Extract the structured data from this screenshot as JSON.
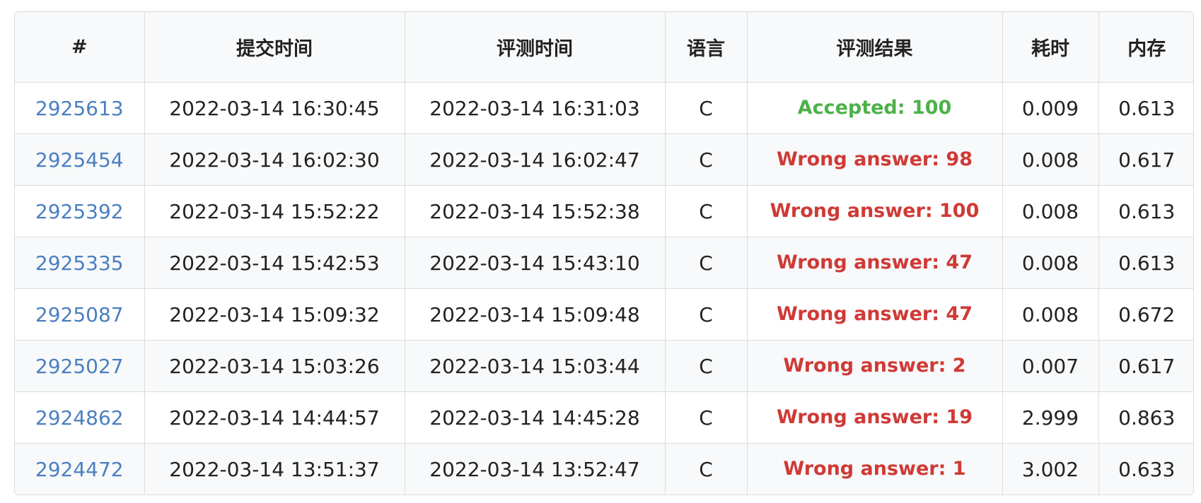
{
  "colors": {
    "link": "#4a7fc1",
    "accepted": "#4cb14a",
    "wrong": "#cf3a36"
  },
  "table": {
    "headers": [
      "#",
      "提交时间",
      "评测时间",
      "语言",
      "评测结果",
      "耗时",
      "内存"
    ],
    "rows": [
      {
        "id": "2925613",
        "submit_time": "2022-03-14 16:30:45",
        "judge_time": "2022-03-14 16:31:03",
        "language": "C",
        "result": "Accepted: 100",
        "status": "accepted",
        "time": "0.009",
        "memory": "0.613"
      },
      {
        "id": "2925454",
        "submit_time": "2022-03-14 16:02:30",
        "judge_time": "2022-03-14 16:02:47",
        "language": "C",
        "result": "Wrong answer: 98",
        "status": "wrong",
        "time": "0.008",
        "memory": "0.617"
      },
      {
        "id": "2925392",
        "submit_time": "2022-03-14 15:52:22",
        "judge_time": "2022-03-14 15:52:38",
        "language": "C",
        "result": "Wrong answer: 100",
        "status": "wrong",
        "time": "0.008",
        "memory": "0.613"
      },
      {
        "id": "2925335",
        "submit_time": "2022-03-14 15:42:53",
        "judge_time": "2022-03-14 15:43:10",
        "language": "C",
        "result": "Wrong answer: 47",
        "status": "wrong",
        "time": "0.008",
        "memory": "0.613"
      },
      {
        "id": "2925087",
        "submit_time": "2022-03-14 15:09:32",
        "judge_time": "2022-03-14 15:09:48",
        "language": "C",
        "result": "Wrong answer: 47",
        "status": "wrong",
        "time": "0.008",
        "memory": "0.672"
      },
      {
        "id": "2925027",
        "submit_time": "2022-03-14 15:03:26",
        "judge_time": "2022-03-14 15:03:44",
        "language": "C",
        "result": "Wrong answer: 2",
        "status": "wrong",
        "time": "0.007",
        "memory": "0.617"
      },
      {
        "id": "2924862",
        "submit_time": "2022-03-14 14:44:57",
        "judge_time": "2022-03-14 14:45:28",
        "language": "C",
        "result": "Wrong answer: 19",
        "status": "wrong",
        "time": "2.999",
        "memory": "0.863"
      },
      {
        "id": "2924472",
        "submit_time": "2022-03-14 13:51:37",
        "judge_time": "2022-03-14 13:52:47",
        "language": "C",
        "result": "Wrong answer: 1",
        "status": "wrong",
        "time": "3.002",
        "memory": "0.633"
      }
    ]
  }
}
